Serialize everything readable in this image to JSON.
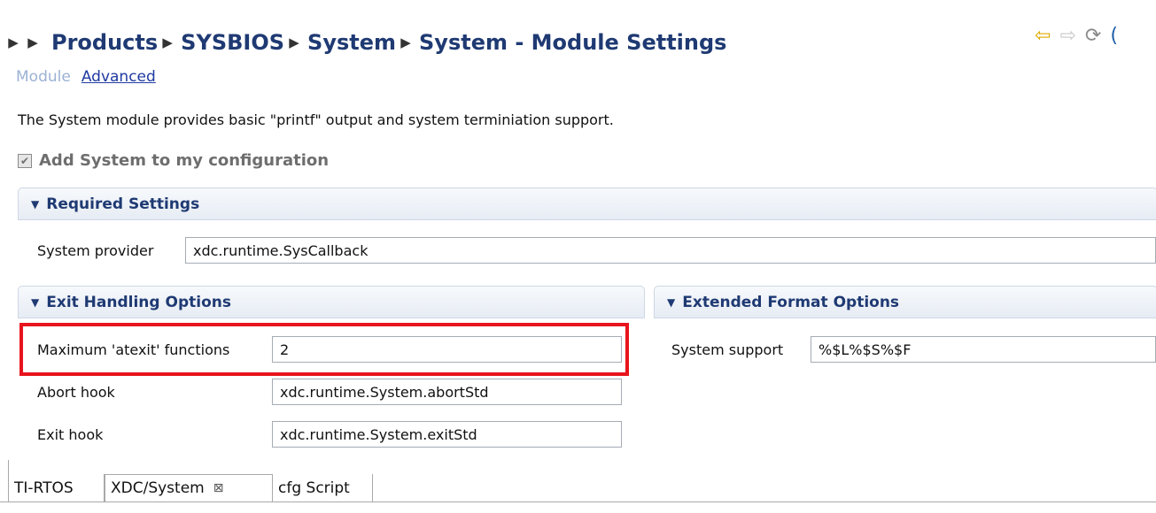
{
  "breadcrumb": {
    "items": [
      "Products",
      "SYSBIOS",
      "System",
      "System - Module Settings"
    ]
  },
  "nav_icons": [
    "back-arrow-icon",
    "forward-arrow-icon",
    "refresh-icon",
    "help-icon"
  ],
  "page_tabs": {
    "module": "Module",
    "advanced": "Advanced"
  },
  "description": "The System module provides basic \"printf\" output and system terminiation support.",
  "add_to_config": {
    "label": "Add System to my configuration",
    "checked": true
  },
  "required_settings": {
    "title": "Required Settings",
    "system_provider_label": "System provider",
    "system_provider_value": "xdc.runtime.SysCallback"
  },
  "exit_handling": {
    "title": "Exit Handling Options",
    "max_atexit_label": "Maximum 'atexit' functions",
    "max_atexit_value": "2",
    "abort_hook_label": "Abort hook",
    "abort_hook_value": "xdc.runtime.System.abortStd",
    "exit_hook_label": "Exit hook",
    "exit_hook_value": "xdc.runtime.System.exitStd"
  },
  "extended_format": {
    "title": "Extended Format Options",
    "system_support_label": "System support",
    "system_support_value": "%$L%$S%$F"
  },
  "bottom_tabs": {
    "tirtos": "TI-RTOS",
    "xdc_system": "XDC/System",
    "cfg_script": "cfg Script"
  },
  "colors": {
    "accent": "#1f3a73",
    "highlight": "#e8141d"
  }
}
